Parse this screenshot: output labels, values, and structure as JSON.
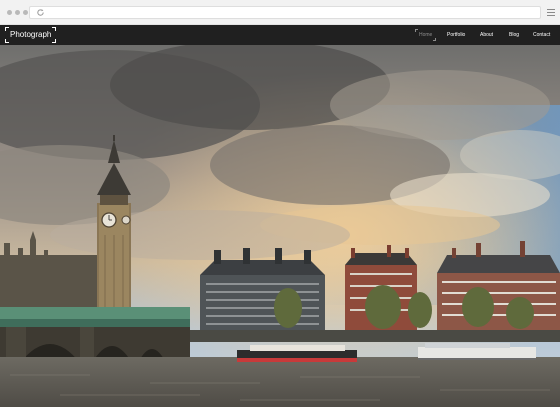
{
  "browser": {
    "reload_icon": "reload-icon",
    "menu_icon": "hamburger-menu-icon"
  },
  "site": {
    "logo_text": "Photograph",
    "nav": [
      {
        "label": "Home",
        "active": true
      },
      {
        "label": "Portfolio",
        "active": false
      },
      {
        "label": "About",
        "active": false
      },
      {
        "label": "Blog",
        "active": false
      },
      {
        "label": "Contact",
        "active": false
      }
    ]
  },
  "hero": {
    "subject": "London skyline photo with Big Ben, Westminster Bridge and the River Thames under a cloudy sunset sky"
  },
  "colors": {
    "navbar_bg": "#202020",
    "nav_text": "#ffffff",
    "nav_active_text": "#8c8c8c"
  }
}
